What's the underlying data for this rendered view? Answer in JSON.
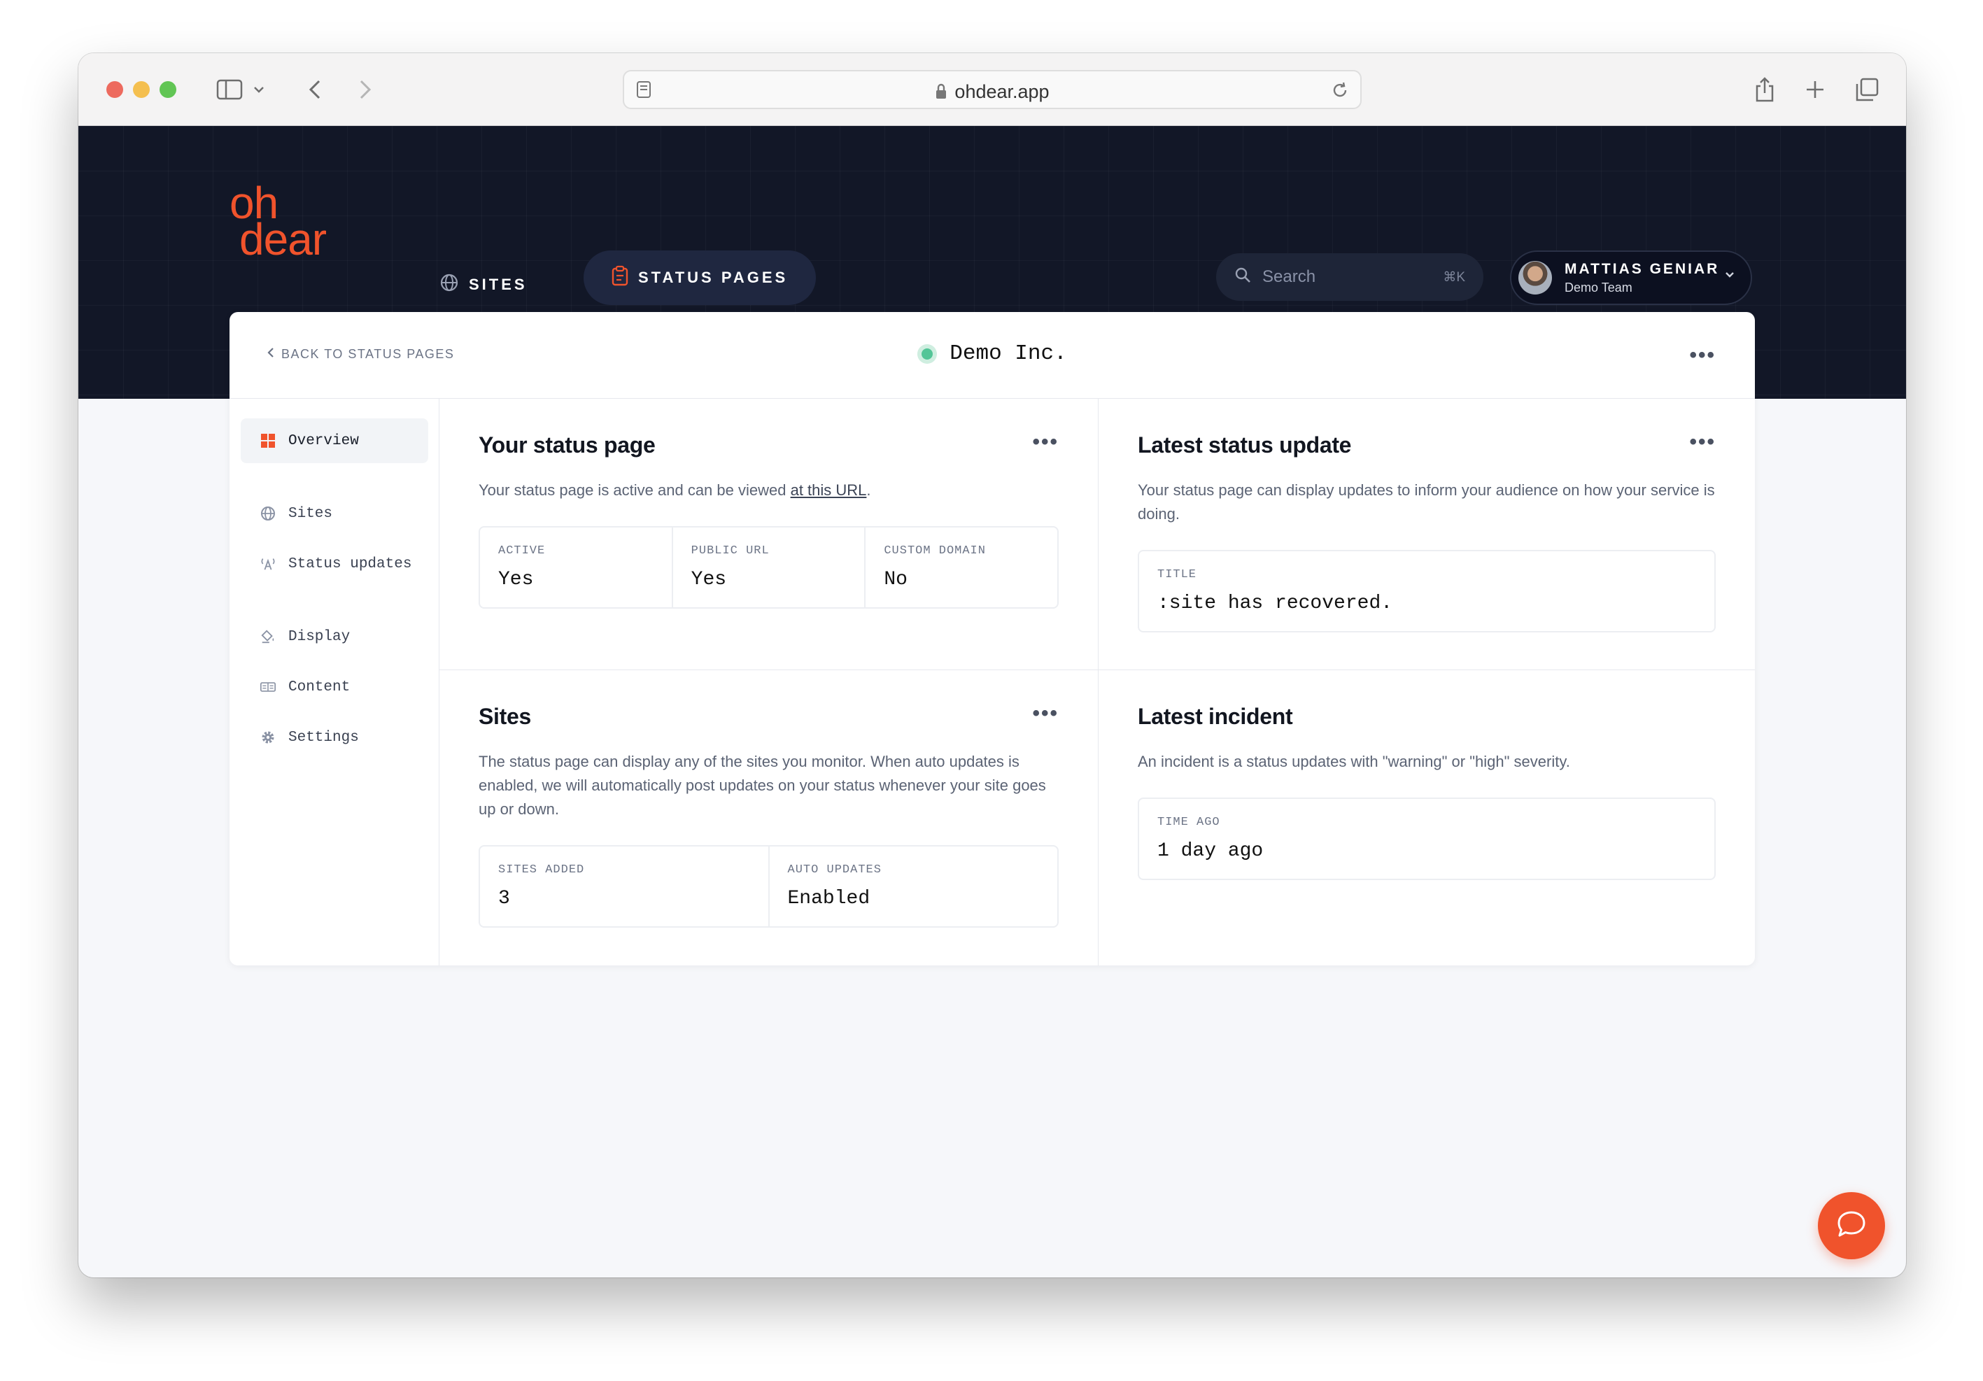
{
  "browser": {
    "url": "ohdear.app"
  },
  "brand": {
    "logo_line1": "oh",
    "logo_line2": "dear",
    "accent": "#f0532c",
    "header_bg": "#121727"
  },
  "nav": {
    "sites_label": "SITES",
    "status_pages_label": "STATUS PAGES"
  },
  "search": {
    "placeholder": "Search",
    "shortcut": "⌘K"
  },
  "user": {
    "name": "MATTIAS GENIAR",
    "team": "Demo Team"
  },
  "card": {
    "back_label": "BACK TO STATUS PAGES",
    "title": "Demo Inc.",
    "status_color": "#53c597"
  },
  "sidebar": {
    "items": [
      {
        "label": "Overview",
        "icon": "grid-icon",
        "active": true
      },
      {
        "label": "Sites",
        "icon": "globe-icon"
      },
      {
        "label": "Status updates",
        "icon": "broadcast-icon"
      },
      {
        "label": "Display",
        "icon": "paint-bucket-icon"
      },
      {
        "label": "Content",
        "icon": "text-box-icon"
      },
      {
        "label": "Settings",
        "icon": "gear-icon"
      }
    ]
  },
  "panels": {
    "status_page": {
      "title": "Your status page",
      "desc_before": "Your status page is active and can be viewed ",
      "desc_link": "at this URL",
      "desc_after": ".",
      "stats": [
        {
          "label": "ACTIVE",
          "value": "Yes"
        },
        {
          "label": "PUBLIC URL",
          "value": "Yes"
        },
        {
          "label": "CUSTOM DOMAIN",
          "value": "No"
        }
      ]
    },
    "latest_update": {
      "title": "Latest status update",
      "desc": "Your status page can display updates to inform your audience on how your service is doing.",
      "stats": [
        {
          "label": "TITLE",
          "value": ":site has recovered."
        }
      ]
    },
    "sites": {
      "title": "Sites",
      "desc": "The status page can display any of the sites you monitor. When auto updates is enabled, we will automatically post updates on your status whenever your site goes up or down.",
      "stats": [
        {
          "label": "SITES ADDED",
          "value": "3"
        },
        {
          "label": "AUTO UPDATES",
          "value": "Enabled"
        }
      ]
    },
    "latest_incident": {
      "title": "Latest incident",
      "desc": "An incident is a status updates with \"warning\" or \"high\" severity.",
      "stats": [
        {
          "label": "TIME AGO",
          "value": "1 day ago"
        }
      ]
    }
  }
}
